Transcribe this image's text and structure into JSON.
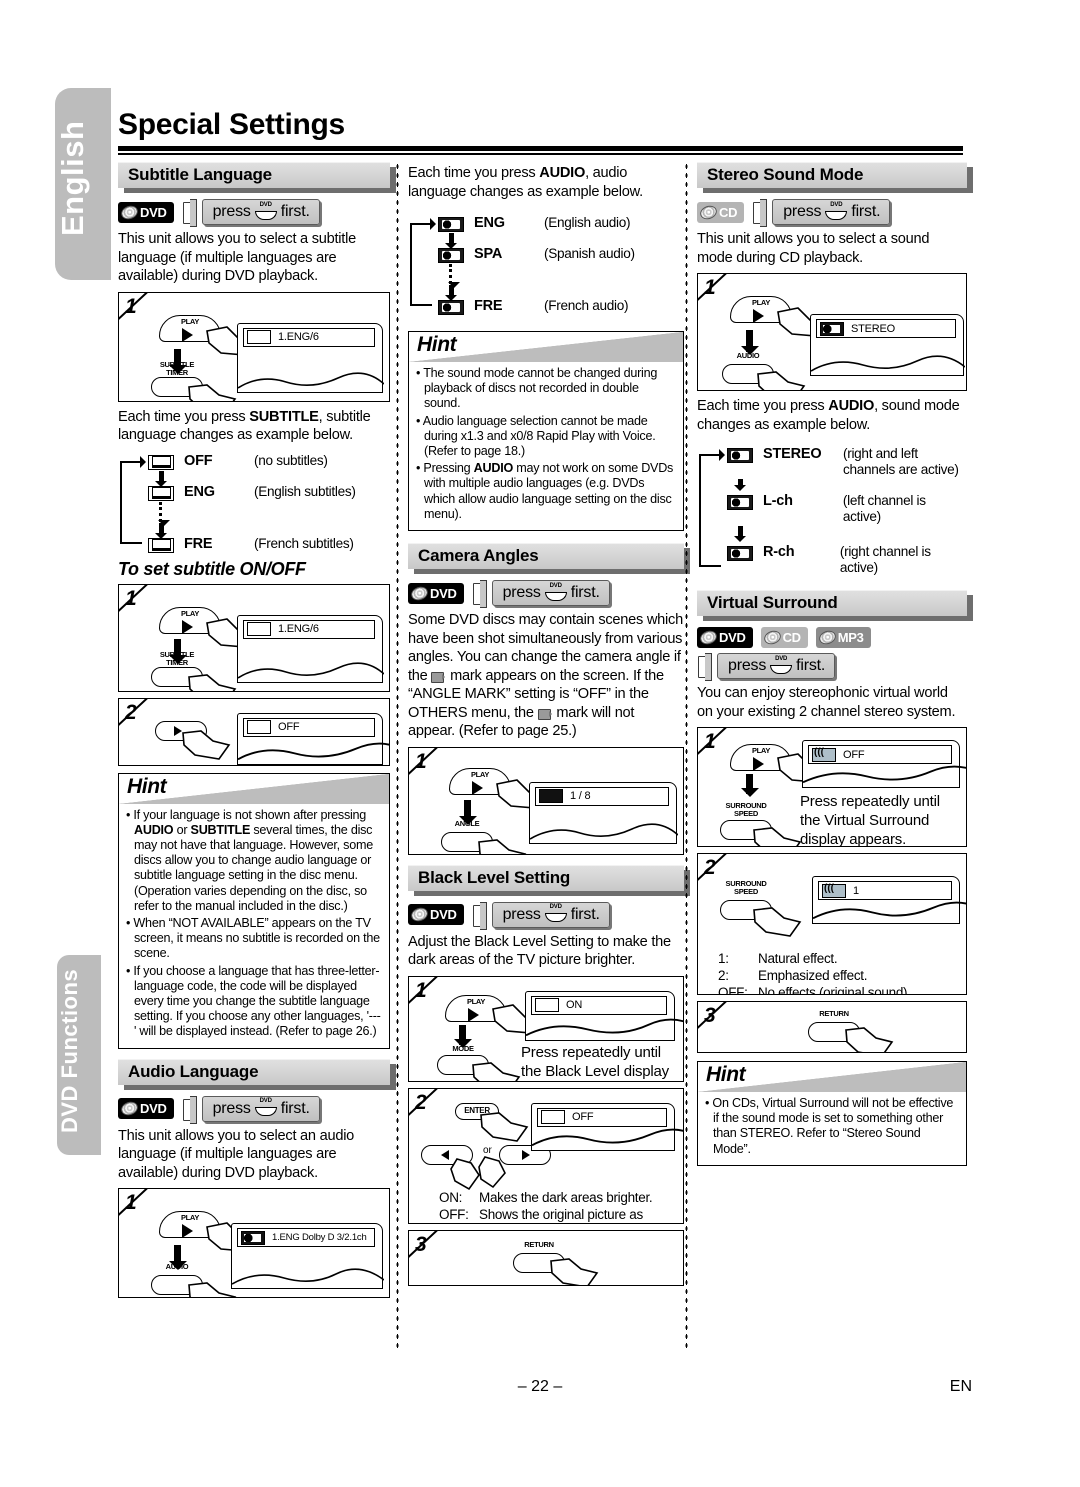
{
  "page": {
    "title": "Special Settings",
    "page_number": "– 22 –",
    "lang_code": "EN",
    "side_tab_top": "English",
    "side_tab_bottom": "DVD Functions"
  },
  "press_first": {
    "pre": "press",
    "button": "DVD",
    "post": "first."
  },
  "left": {
    "subtitle_language": {
      "heading": "Subtitle Language",
      "discs": [
        "DVD"
      ],
      "intro": "This unit allows you to select a subtitle language (if multiple languages are available) during DVD playback.",
      "step1": {
        "num": "1",
        "key_top": "PLAY",
        "key_bottom": "SUBTITLE\nTIMER",
        "osd": "1.ENG/6"
      },
      "after_text_a": "Each time you press ",
      "after_text_b": "SUBTITLE",
      "after_text_c": ", subtitle language changes as example below.",
      "flow": [
        {
          "code": "OFF",
          "desc": "(no subtitles)"
        },
        {
          "code": "ENG",
          "desc": "(English subtitles)"
        },
        {
          "code": "FRE",
          "desc": "(French subtitles)"
        }
      ],
      "onoff_heading": "To set subtitle ON/OFF",
      "onoff_step1": {
        "num": "1",
        "key_top": "PLAY",
        "key_bottom": "SUBTITLE\nTIMER",
        "osd": "1.ENG/6"
      },
      "onoff_step2": {
        "num": "2",
        "osd": "OFF"
      }
    },
    "hint1": {
      "title": "Hint",
      "items": [
        "If your language is not shown after pressing AUDIO or SUBTITLE several times, the disc may not have that language. However, some discs allow you to change audio language or subtitle language setting in the disc menu. (Operation varies depending on the disc, so refer to the manual included in the disc.)",
        "When “NOT AVAILABLE” appears on the TV screen, it means no subtitle is recorded on the scene.",
        "If you choose a language that has three-letter-language code, the code will be displayed every time you change the subtitle language setting. If you choose any other languages, '---' will be displayed instead. (Refer to page 26.)"
      ]
    },
    "audio_language": {
      "heading": "Audio Language",
      "discs": [
        "DVD"
      ],
      "intro": "This unit allows you to select an audio language (if multiple languages are available) during DVD playback.",
      "step1": {
        "num": "1",
        "key_top": "PLAY",
        "key_bottom": "AUDIO",
        "osd": "1.ENG  Dolby D  3/2.1ch"
      }
    }
  },
  "mid": {
    "audio_flow_intro_a": "Each time you press ",
    "audio_flow_intro_b": "AUDIO",
    "audio_flow_intro_c": ", audio language changes as example below.",
    "audio_flow": [
      {
        "code": "ENG",
        "desc": "(English audio)"
      },
      {
        "code": "SPA",
        "desc": "(Spanish audio)"
      },
      {
        "code": "FRE",
        "desc": "(French audio)"
      }
    ],
    "hint2": {
      "title": "Hint",
      "items": [
        "The sound mode cannot be changed during playback of discs not recorded in double sound.",
        "Audio language selection cannot be made during x1.3 and x0/8 Rapid Play with Voice. (Refer to page 18.)",
        "Pressing AUDIO may not work on some DVDs with multiple audio languages (e.g. DVDs which allow audio language setting on the disc menu)."
      ]
    },
    "camera_angles": {
      "heading": "Camera Angles",
      "discs": [
        "DVD"
      ],
      "intro": "Some DVD discs may contain scenes which have been shot simultaneously from various angles. You can change the camera angle if the  mark appears on the screen. If the “ANGLE MARK” setting is “OFF” in the OTHERS menu, the  mark will not appear. (Refer to page 25.)",
      "step1": {
        "num": "1",
        "key_top": "PLAY",
        "key_bottom": "ANGLE",
        "osd": "1 / 8"
      }
    },
    "black_level": {
      "heading": "Black Level Setting",
      "discs": [
        "DVD"
      ],
      "intro": "Adjust the Black Level Setting to make the dark areas of the TV picture brighter.",
      "step1": {
        "num": "1",
        "key_top": "PLAY",
        "key_bottom": "MODE",
        "osd": "ON",
        "note": "Press repeatedly until the Black Level display appears."
      },
      "step2": {
        "num": "2",
        "key_top": "ENTER",
        "or_label": "or",
        "osd": "OFF",
        "options": [
          {
            "key": "ON:",
            "desc": "Makes the dark areas brighter."
          },
          {
            "key": "OFF:",
            "desc": "Shows the original picture as recorded."
          }
        ]
      },
      "step3": {
        "num": "3",
        "key": "RETURN"
      }
    }
  },
  "right": {
    "stereo_sound_mode": {
      "heading": "Stereo Sound Mode",
      "discs": [
        "CD"
      ],
      "intro": "This unit allows you to select a sound mode during CD playback.",
      "step1": {
        "num": "1",
        "key_top": "PLAY",
        "key_bottom": "AUDIO",
        "osd": "STEREO"
      },
      "after_a": "Each time you press ",
      "after_b": "AUDIO",
      "after_c": ", sound mode changes as example below.",
      "flow": [
        {
          "code": "STEREO",
          "desc": "(right and left channels are active)"
        },
        {
          "code": "L-ch",
          "desc": "(left channel is active)"
        },
        {
          "code": "R-ch",
          "desc": "(right channel is active)"
        }
      ]
    },
    "virtual_surround": {
      "heading": "Virtual Surround",
      "discs": [
        "DVD",
        "CD",
        "MP3"
      ],
      "intro": "You can enjoy stereophonic virtual world on your existing 2 channel stereo system.",
      "step1": {
        "num": "1",
        "key_top": "PLAY",
        "key_bottom": "SURROUND\nSPEED",
        "osd": "OFF",
        "note": "Press repeatedly until the Virtual Surround display appears."
      },
      "step2": {
        "num": "2",
        "key_top": "SURROUND\nSPEED",
        "osd": "1",
        "options": [
          {
            "key": "1:",
            "desc": "Natural effect."
          },
          {
            "key": "2:",
            "desc": "Emphasized effect."
          },
          {
            "key": "OFF:",
            "desc": "No effects (original sound)."
          }
        ]
      },
      "step3": {
        "num": "3",
        "key": "RETURN"
      }
    },
    "hint3": {
      "title": "Hint",
      "items": [
        "On CDs, Virtual Surround will not be effective if the sound mode is set to something other than STEREO. Refer to “Stereo Sound Mode”."
      ]
    }
  }
}
